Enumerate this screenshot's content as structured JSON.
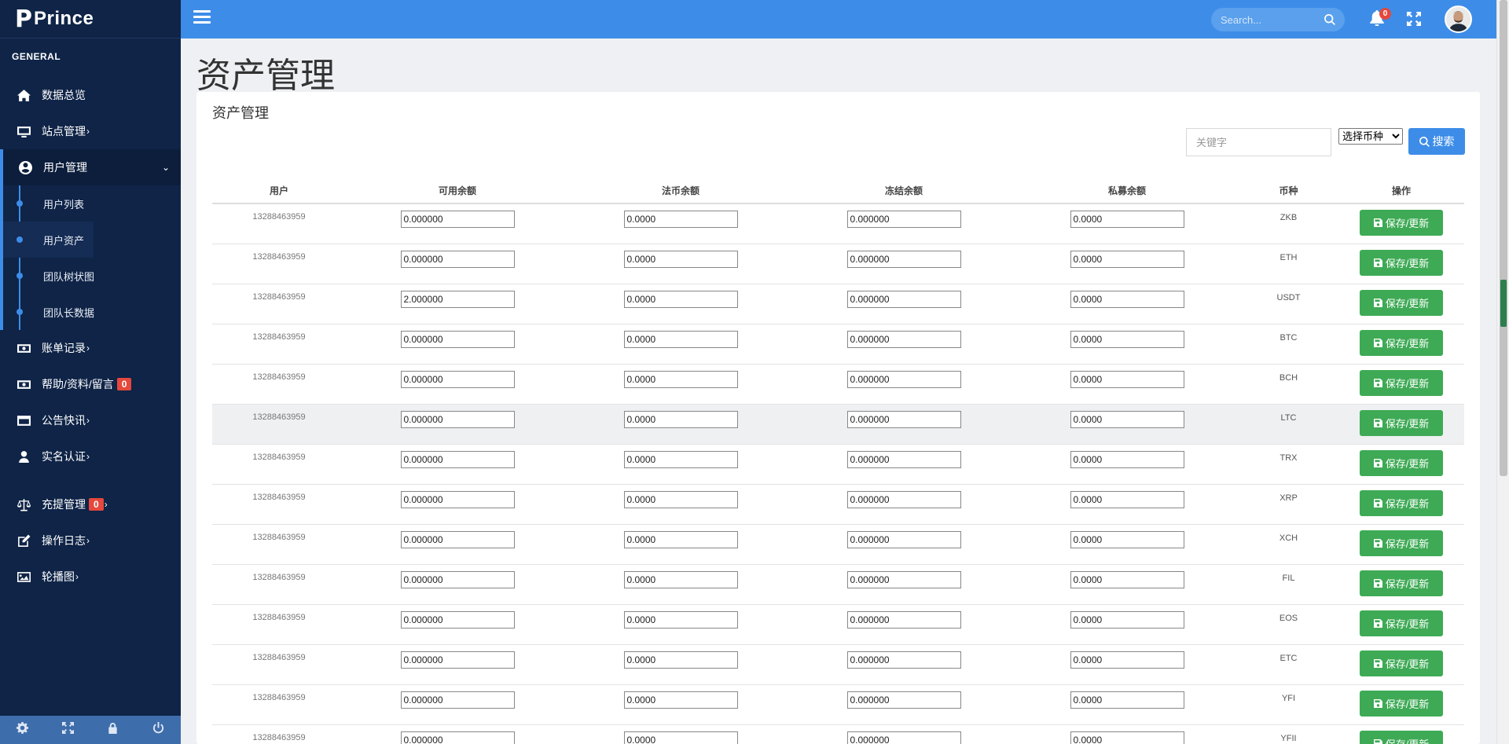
{
  "app": {
    "logo_letter": "P",
    "name": "Prince"
  },
  "sidebar": {
    "section_label": "GENERAL",
    "items": [
      {
        "icon": "home-icon",
        "label": "数据总览",
        "arrow": "",
        "badge": ""
      },
      {
        "icon": "monitor-icon",
        "label": "站点管理",
        "arrow": "›",
        "badge": ""
      },
      {
        "icon": "user-circle-icon",
        "label": "用户管理",
        "arrow": "",
        "badge": "",
        "chevron": "⌄",
        "active": true
      },
      {
        "icon": "money-icon",
        "label": "账单记录",
        "arrow": "›",
        "badge": ""
      },
      {
        "icon": "money-icon",
        "label": "帮助/资料/留言",
        "arrow": "",
        "badge": "0"
      },
      {
        "icon": "window-icon",
        "label": "公告快讯",
        "arrow": "›",
        "badge": ""
      },
      {
        "icon": "user-icon",
        "label": "实名认证",
        "arrow": "›",
        "badge": ""
      },
      {
        "icon": "balance-scale-icon",
        "label": "充提管理",
        "arrow": "›",
        "badge": "0"
      },
      {
        "icon": "edit-icon",
        "label": "操作日志",
        "arrow": "›",
        "badge": ""
      },
      {
        "icon": "image-icon",
        "label": "轮播图",
        "arrow": "›",
        "badge": ""
      }
    ],
    "sub_items": [
      "用户列表",
      "用户资产",
      "团队树状图",
      "团队长数据"
    ]
  },
  "topbar": {
    "search_placeholder": "Search...",
    "notification_count": "0"
  },
  "page": {
    "title": "资产管理",
    "card_title": "资产管理"
  },
  "filters": {
    "keyword_placeholder": "关键字",
    "coin_select_value": "选择币种",
    "search_label": "搜索"
  },
  "table": {
    "headers": [
      "用户",
      "可用余额",
      "法币余额",
      "冻结余额",
      "私募余额",
      "币种",
      "操作"
    ],
    "save_label": "保存/更新",
    "rows": [
      {
        "user": "13288463959",
        "available": "0.000000",
        "fiat": "0.0000",
        "frozen": "0.000000",
        "private": "0.0000",
        "coin": "ZKB"
      },
      {
        "user": "13288463959",
        "available": "0.000000",
        "fiat": "0.0000",
        "frozen": "0.000000",
        "private": "0.0000",
        "coin": "ETH"
      },
      {
        "user": "13288463959",
        "available": "2.000000",
        "fiat": "0.0000",
        "frozen": "0.000000",
        "private": "0.0000",
        "coin": "USDT"
      },
      {
        "user": "13288463959",
        "available": "0.000000",
        "fiat": "0.0000",
        "frozen": "0.000000",
        "private": "0.0000",
        "coin": "BTC"
      },
      {
        "user": "13288463959",
        "available": "0.000000",
        "fiat": "0.0000",
        "frozen": "0.000000",
        "private": "0.0000",
        "coin": "BCH"
      },
      {
        "user": "13288463959",
        "available": "0.000000",
        "fiat": "0.0000",
        "frozen": "0.000000",
        "private": "0.0000",
        "coin": "LTC",
        "highlight": true
      },
      {
        "user": "13288463959",
        "available": "0.000000",
        "fiat": "0.0000",
        "frozen": "0.000000",
        "private": "0.0000",
        "coin": "TRX"
      },
      {
        "user": "13288463959",
        "available": "0.000000",
        "fiat": "0.0000",
        "frozen": "0.000000",
        "private": "0.0000",
        "coin": "XRP"
      },
      {
        "user": "13288463959",
        "available": "0.000000",
        "fiat": "0.0000",
        "frozen": "0.000000",
        "private": "0.0000",
        "coin": "XCH"
      },
      {
        "user": "13288463959",
        "available": "0.000000",
        "fiat": "0.0000",
        "frozen": "0.000000",
        "private": "0.0000",
        "coin": "FIL"
      },
      {
        "user": "13288463959",
        "available": "0.000000",
        "fiat": "0.0000",
        "frozen": "0.000000",
        "private": "0.0000",
        "coin": "EOS"
      },
      {
        "user": "13288463959",
        "available": "0.000000",
        "fiat": "0.0000",
        "frozen": "0.000000",
        "private": "0.0000",
        "coin": "ETC"
      },
      {
        "user": "13288463959",
        "available": "0.000000",
        "fiat": "0.0000",
        "frozen": "0.000000",
        "private": "0.0000",
        "coin": "YFI"
      },
      {
        "user": "13288463959",
        "available": "0.000000",
        "fiat": "0.0000",
        "frozen": "0.000000",
        "private": "0.0000",
        "coin": "YFII"
      }
    ]
  },
  "colors": {
    "sidebar_bg": "#0f2447",
    "topbar_bg": "#3d8de8",
    "accent": "#3d8de8",
    "save_button": "#3eaa55",
    "badge": "#e5483c"
  }
}
